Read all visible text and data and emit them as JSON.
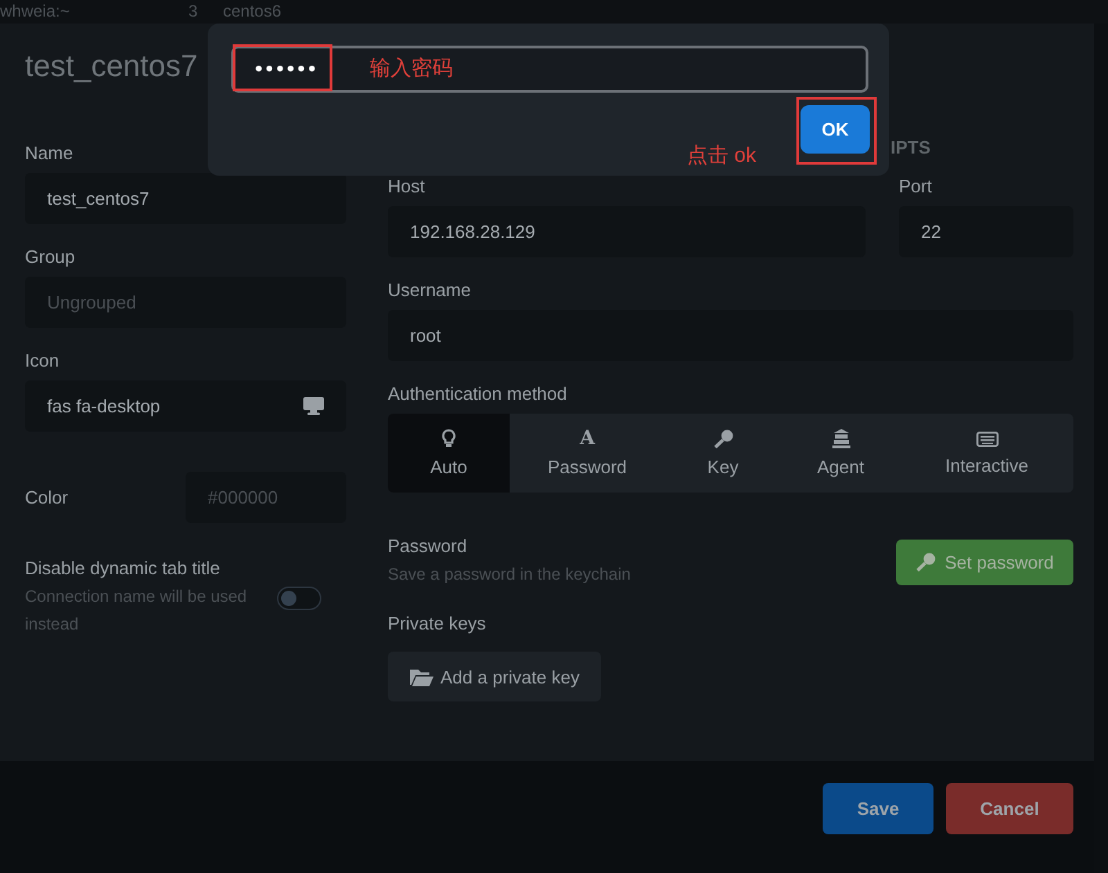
{
  "background_tabs": [
    {
      "label": "whweia:~"
    },
    {
      "label": "3"
    },
    {
      "label": "centos6"
    }
  ],
  "connection": {
    "title": "test_centos7",
    "name": {
      "label": "Name",
      "value": "test_centos7"
    },
    "group": {
      "label": "Group",
      "placeholder": "Ungrouped"
    },
    "icon": {
      "label": "Icon",
      "value": "fas fa-desktop"
    },
    "color": {
      "label": "Color",
      "placeholder": "#000000"
    },
    "dynamic_title": {
      "label": "Disable dynamic tab title",
      "hint": "Connection name will be used instead",
      "on": false
    },
    "section_tab": "IPTS",
    "host": {
      "label": "Host",
      "value": "192.168.28.129"
    },
    "port": {
      "label": "Port",
      "value": "22"
    },
    "username": {
      "label": "Username",
      "value": "root"
    },
    "auth_label": "Authentication method",
    "auth_methods": [
      {
        "kind": "bulb",
        "label": "Auto",
        "selected": true
      },
      {
        "kind": "letter",
        "label": "Password",
        "selected": false,
        "glyph": "A"
      },
      {
        "kind": "key",
        "label": "Key",
        "selected": false
      },
      {
        "kind": "agent",
        "label": "Agent",
        "selected": false
      },
      {
        "kind": "keyboard",
        "label": "Interactive",
        "selected": false
      }
    ],
    "password": {
      "label": "Password",
      "hint": "Save a password in the keychain",
      "button": "Set password"
    },
    "private_keys": {
      "label": "Private keys",
      "button": "Add a private key"
    },
    "footer": {
      "save": "Save",
      "cancel": "Cancel"
    }
  },
  "prompt": {
    "value": "••••••",
    "button": "OK"
  },
  "annotations": [
    {
      "text": "输入密码"
    },
    {
      "text": "点击 ok"
    }
  ]
}
